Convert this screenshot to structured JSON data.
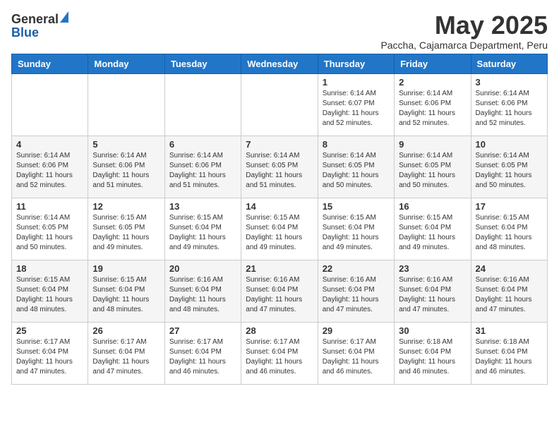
{
  "header": {
    "logo_general": "General",
    "logo_blue": "Blue",
    "month_title": "May 2025",
    "subtitle": "Paccha, Cajamarca Department, Peru"
  },
  "weekdays": [
    "Sunday",
    "Monday",
    "Tuesday",
    "Wednesday",
    "Thursday",
    "Friday",
    "Saturday"
  ],
  "weeks": [
    [
      {
        "day": "",
        "info": ""
      },
      {
        "day": "",
        "info": ""
      },
      {
        "day": "",
        "info": ""
      },
      {
        "day": "",
        "info": ""
      },
      {
        "day": "1",
        "info": "Sunrise: 6:14 AM\nSunset: 6:07 PM\nDaylight: 11 hours\nand 52 minutes."
      },
      {
        "day": "2",
        "info": "Sunrise: 6:14 AM\nSunset: 6:06 PM\nDaylight: 11 hours\nand 52 minutes."
      },
      {
        "day": "3",
        "info": "Sunrise: 6:14 AM\nSunset: 6:06 PM\nDaylight: 11 hours\nand 52 minutes."
      }
    ],
    [
      {
        "day": "4",
        "info": "Sunrise: 6:14 AM\nSunset: 6:06 PM\nDaylight: 11 hours\nand 52 minutes."
      },
      {
        "day": "5",
        "info": "Sunrise: 6:14 AM\nSunset: 6:06 PM\nDaylight: 11 hours\nand 51 minutes."
      },
      {
        "day": "6",
        "info": "Sunrise: 6:14 AM\nSunset: 6:06 PM\nDaylight: 11 hours\nand 51 minutes."
      },
      {
        "day": "7",
        "info": "Sunrise: 6:14 AM\nSunset: 6:05 PM\nDaylight: 11 hours\nand 51 minutes."
      },
      {
        "day": "8",
        "info": "Sunrise: 6:14 AM\nSunset: 6:05 PM\nDaylight: 11 hours\nand 50 minutes."
      },
      {
        "day": "9",
        "info": "Sunrise: 6:14 AM\nSunset: 6:05 PM\nDaylight: 11 hours\nand 50 minutes."
      },
      {
        "day": "10",
        "info": "Sunrise: 6:14 AM\nSunset: 6:05 PM\nDaylight: 11 hours\nand 50 minutes."
      }
    ],
    [
      {
        "day": "11",
        "info": "Sunrise: 6:14 AM\nSunset: 6:05 PM\nDaylight: 11 hours\nand 50 minutes."
      },
      {
        "day": "12",
        "info": "Sunrise: 6:15 AM\nSunset: 6:05 PM\nDaylight: 11 hours\nand 49 minutes."
      },
      {
        "day": "13",
        "info": "Sunrise: 6:15 AM\nSunset: 6:04 PM\nDaylight: 11 hours\nand 49 minutes."
      },
      {
        "day": "14",
        "info": "Sunrise: 6:15 AM\nSunset: 6:04 PM\nDaylight: 11 hours\nand 49 minutes."
      },
      {
        "day": "15",
        "info": "Sunrise: 6:15 AM\nSunset: 6:04 PM\nDaylight: 11 hours\nand 49 minutes."
      },
      {
        "day": "16",
        "info": "Sunrise: 6:15 AM\nSunset: 6:04 PM\nDaylight: 11 hours\nand 49 minutes."
      },
      {
        "day": "17",
        "info": "Sunrise: 6:15 AM\nSunset: 6:04 PM\nDaylight: 11 hours\nand 48 minutes."
      }
    ],
    [
      {
        "day": "18",
        "info": "Sunrise: 6:15 AM\nSunset: 6:04 PM\nDaylight: 11 hours\nand 48 minutes."
      },
      {
        "day": "19",
        "info": "Sunrise: 6:15 AM\nSunset: 6:04 PM\nDaylight: 11 hours\nand 48 minutes."
      },
      {
        "day": "20",
        "info": "Sunrise: 6:16 AM\nSunset: 6:04 PM\nDaylight: 11 hours\nand 48 minutes."
      },
      {
        "day": "21",
        "info": "Sunrise: 6:16 AM\nSunset: 6:04 PM\nDaylight: 11 hours\nand 47 minutes."
      },
      {
        "day": "22",
        "info": "Sunrise: 6:16 AM\nSunset: 6:04 PM\nDaylight: 11 hours\nand 47 minutes."
      },
      {
        "day": "23",
        "info": "Sunrise: 6:16 AM\nSunset: 6:04 PM\nDaylight: 11 hours\nand 47 minutes."
      },
      {
        "day": "24",
        "info": "Sunrise: 6:16 AM\nSunset: 6:04 PM\nDaylight: 11 hours\nand 47 minutes."
      }
    ],
    [
      {
        "day": "25",
        "info": "Sunrise: 6:17 AM\nSunset: 6:04 PM\nDaylight: 11 hours\nand 47 minutes."
      },
      {
        "day": "26",
        "info": "Sunrise: 6:17 AM\nSunset: 6:04 PM\nDaylight: 11 hours\nand 47 minutes."
      },
      {
        "day": "27",
        "info": "Sunrise: 6:17 AM\nSunset: 6:04 PM\nDaylight: 11 hours\nand 46 minutes."
      },
      {
        "day": "28",
        "info": "Sunrise: 6:17 AM\nSunset: 6:04 PM\nDaylight: 11 hours\nand 46 minutes."
      },
      {
        "day": "29",
        "info": "Sunrise: 6:17 AM\nSunset: 6:04 PM\nDaylight: 11 hours\nand 46 minutes."
      },
      {
        "day": "30",
        "info": "Sunrise: 6:18 AM\nSunset: 6:04 PM\nDaylight: 11 hours\nand 46 minutes."
      },
      {
        "day": "31",
        "info": "Sunrise: 6:18 AM\nSunset: 6:04 PM\nDaylight: 11 hours\nand 46 minutes."
      }
    ]
  ]
}
